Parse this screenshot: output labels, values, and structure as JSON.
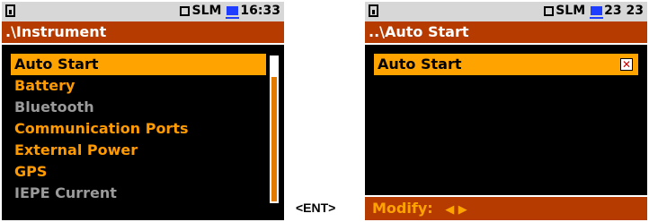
{
  "left_screen": {
    "status": {
      "mode": "SLM",
      "time": "16:33"
    },
    "path": ".\\Instrument",
    "items": [
      {
        "label": "Auto Start",
        "state": "selected"
      },
      {
        "label": "Battery",
        "state": "normal"
      },
      {
        "label": "Bluetooth",
        "state": "disabled"
      },
      {
        "label": "Communication Ports",
        "state": "normal"
      },
      {
        "label": "External Power",
        "state": "normal"
      },
      {
        "label": "GPS",
        "state": "normal"
      },
      {
        "label": "IEPE Current",
        "state": "disabled"
      }
    ]
  },
  "transition_label": "<ENT>",
  "right_screen": {
    "status": {
      "mode": "SLM",
      "time": "23 23"
    },
    "path": "..\\Auto Start",
    "items": [
      {
        "label": "Auto Start",
        "checked": false
      }
    ],
    "modify_label": "Modify:",
    "modify_arrows_icon": "left-right-arrows-icon"
  },
  "colors": {
    "highlight": "#ffa300",
    "header": "#b63b00",
    "item_text": "#ff9a00",
    "disabled_text": "#9a9a9a"
  }
}
